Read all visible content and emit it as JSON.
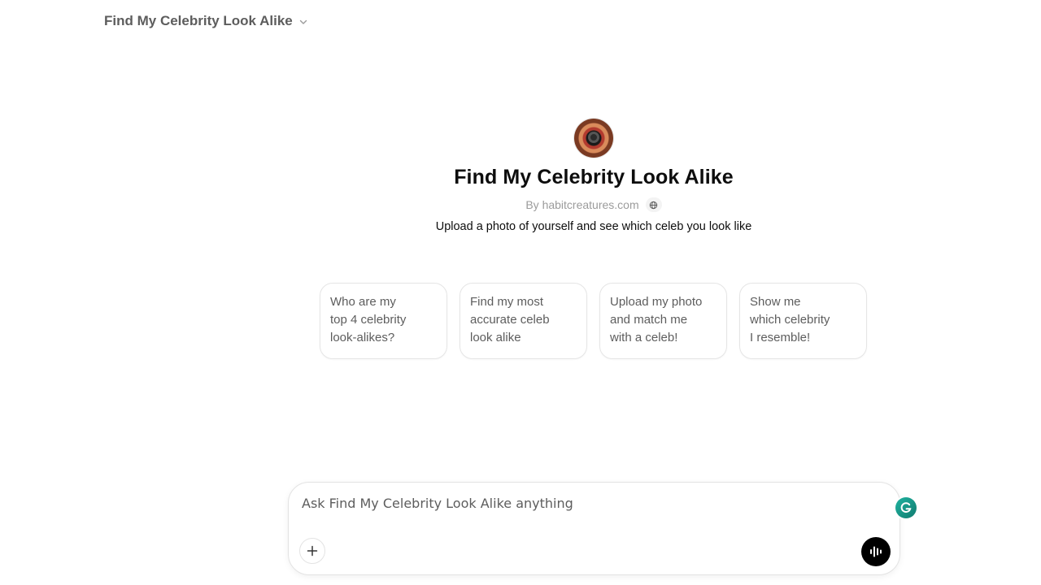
{
  "header": {
    "title": "Find My Celebrity Look Alike",
    "chevron_icon": "chevron-down-icon"
  },
  "hero": {
    "avatar_icon": "camera-avatar",
    "name": "Find My Celebrity Look Alike",
    "byline": "By habitcreatures.com",
    "globe_icon": "globe-icon",
    "description": "Upload a photo of yourself and see which celeb you look like"
  },
  "suggestions": [
    {
      "label": "Who are my\ntop 4 celebrity\nlook-alikes?"
    },
    {
      "label": "Find my most\naccurate celeb\nlook alike"
    },
    {
      "label": "Upload my photo\nand match me\nwith a celeb!"
    },
    {
      "label": "Show me\nwhich celebrity\nI resemble!"
    }
  ],
  "composer": {
    "placeholder": "Ask Find My Celebrity Look Alike anything",
    "value": "",
    "attach_icon": "plus-icon",
    "voice_icon": "voice-waveform-icon",
    "grammarly_icon": "grammarly-icon"
  },
  "colors": {
    "text_primary": "#0d0d0d",
    "text_secondary": "#5d5d5d",
    "muted": "#9b9b9b",
    "border": "#e5e5e5",
    "voice_button": "#000000",
    "grammarly": "#15c39a"
  }
}
